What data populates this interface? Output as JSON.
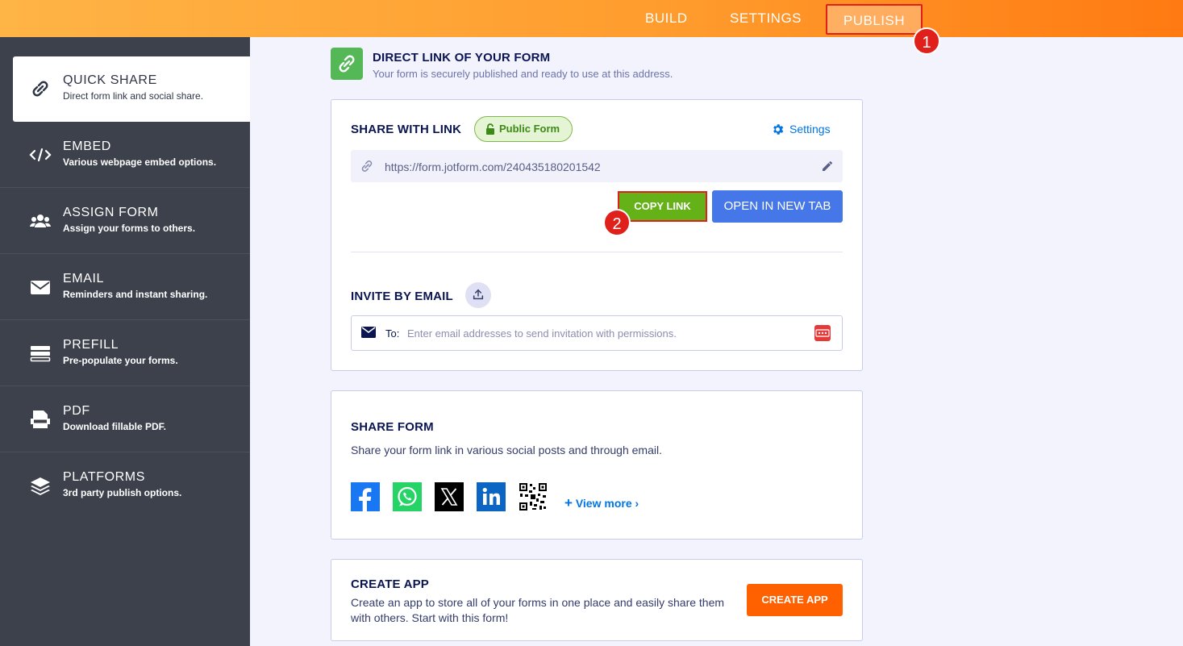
{
  "topbar": {
    "tabs": [
      {
        "label": "BUILD"
      },
      {
        "label": "SETTINGS"
      },
      {
        "label": "PUBLISH"
      }
    ],
    "annotations": [
      "1",
      "2"
    ]
  },
  "sidebar": {
    "items": [
      {
        "title": "QUICK SHARE",
        "subtitle": "Direct form link and social share.",
        "icon": "link-icon"
      },
      {
        "title": "EMBED",
        "subtitle": "Various webpage embed options.",
        "icon": "code-icon"
      },
      {
        "title": "ASSIGN FORM",
        "subtitle": "Assign your forms to others.",
        "icon": "users-icon"
      },
      {
        "title": "EMAIL",
        "subtitle": "Reminders and instant sharing.",
        "icon": "envelope-icon"
      },
      {
        "title": "PREFILL",
        "subtitle": "Pre-populate your forms.",
        "icon": "prefill-icon"
      },
      {
        "title": "PDF",
        "subtitle": "Download fillable PDF.",
        "icon": "pdf-icon"
      },
      {
        "title": "PLATFORMS",
        "subtitle": "3rd party publish options.",
        "icon": "layers-icon"
      }
    ]
  },
  "header": {
    "title": "DIRECT LINK OF YOUR FORM",
    "subtitle": "Your form is securely published and ready to use at this address."
  },
  "share_link": {
    "title": "SHARE WITH LINK",
    "status": "Public Form",
    "settings_label": "Settings",
    "url": "https://form.jotform.com/240435180201542",
    "copy_label": "COPY LINK",
    "open_label": "OPEN IN NEW TAB"
  },
  "invite": {
    "title": "INVITE BY EMAIL",
    "to_label": "To:",
    "placeholder": "Enter email addresses to send invitation with permissions."
  },
  "share_form": {
    "title": "SHARE FORM",
    "description": "Share your form link in various social posts and through email.",
    "socials": [
      "facebook-icon",
      "whatsapp-icon",
      "x-icon",
      "linkedin-icon",
      "qr-code-icon"
    ],
    "view_more": "View more"
  },
  "create_app": {
    "title": "CREATE APP",
    "description": "Create an app to store all of your forms in one place and easily share them with others. Start with this form!",
    "button": "CREATE APP"
  },
  "colors": {
    "topbar_start": "#ffb446",
    "topbar_end": "#ff7a12",
    "sidebar_bg": "#3d414c",
    "copy_button": "#64b118",
    "open_button": "#4677e8",
    "create_app_button": "#ff6100",
    "highlight": "#e0201b",
    "link": "#0075e3"
  }
}
